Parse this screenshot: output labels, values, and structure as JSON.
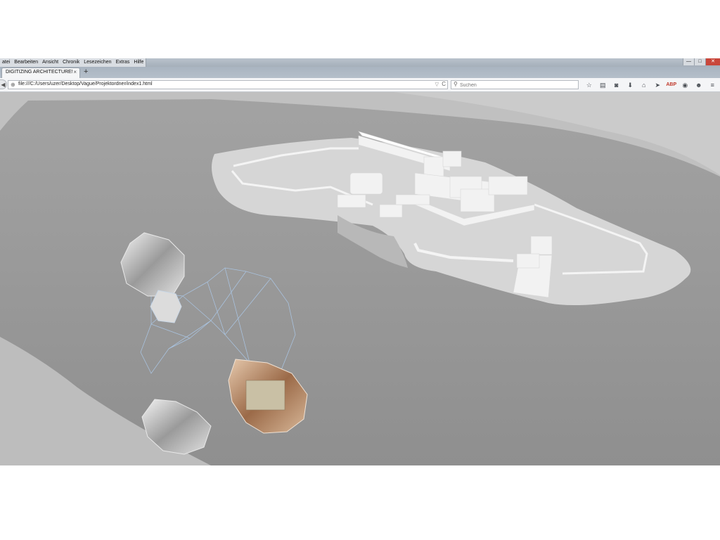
{
  "menu": {
    "items": [
      "atei",
      "Bearbeiten",
      "Ansicht",
      "Chronik",
      "Lesezeichen",
      "Extras",
      "Hilfe"
    ]
  },
  "window_controls": {
    "minimize": "—",
    "maximize": "□",
    "close": "✕"
  },
  "tab": {
    "title": "DIGITIZING ARCHITECTURE!",
    "close": "×"
  },
  "new_tab": "+",
  "navbar": {
    "back": "◀",
    "url": "file:///C:/Users/uzer/Desktop/Vague/Projektordner/index1.html",
    "url_drop": "▽",
    "reload": "C",
    "search_placeholder": "Suchen"
  },
  "toolbar": {
    "icons": [
      "star-icon",
      "reading-list-icon",
      "pocket-icon",
      "download-icon",
      "home-icon",
      "send-icon",
      "adblock-icon",
      "extension-icon",
      "chat-icon",
      "hamburger-menu-icon"
    ],
    "glyphs": [
      "☆",
      "▤",
      "◙",
      "⬇",
      "⌂",
      "➤",
      "ABP",
      "◉",
      "☻",
      "≡"
    ]
  },
  "colors": {
    "water": "#9b9b9b",
    "land": "#c8c8c8",
    "island": "#d6d6d6",
    "buildings": "#f2f2f2",
    "wireframe": "#a9c2de",
    "copper": "#b07c5a"
  }
}
